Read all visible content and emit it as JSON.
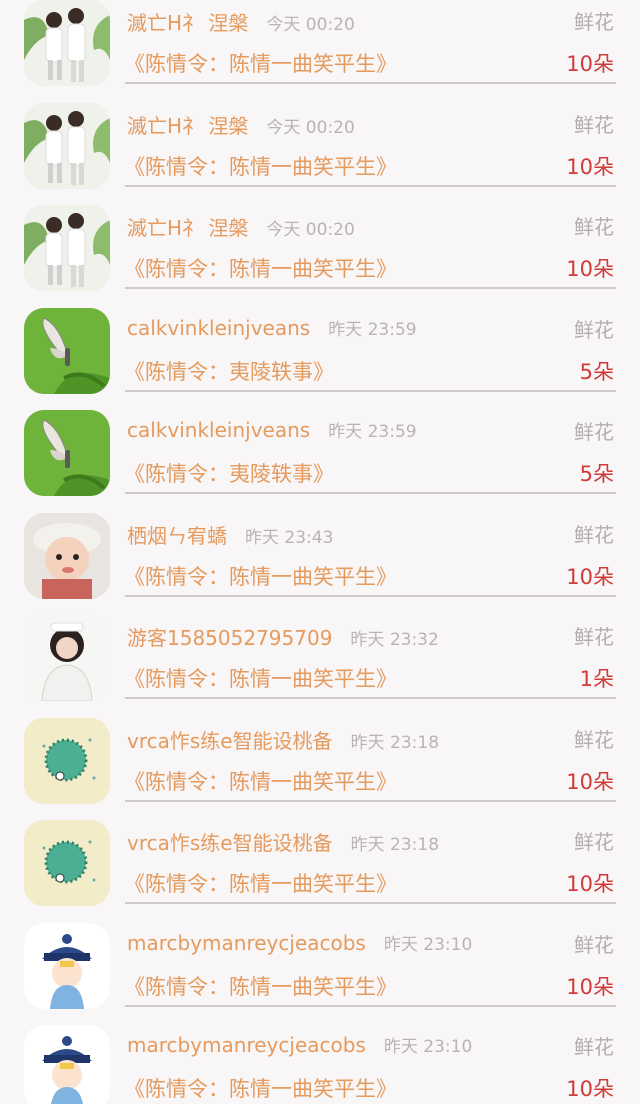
{
  "gift_list": {
    "items": [
      {
        "avatar": "avatar-boys-photo-icon",
        "name": "滅亡H礻 涅槃",
        "time": "今天 00:20",
        "gift": "鲜花",
        "title": "《陈情令：陈情一曲笑平生》",
        "count": "10朵"
      },
      {
        "avatar": "avatar-boys-photo-icon",
        "name": "滅亡H礻 涅槃",
        "time": "今天 00:20",
        "gift": "鲜花",
        "title": "《陈情令：陈情一曲笑平生》",
        "count": "10朵"
      },
      {
        "avatar": "avatar-boys-photo-icon",
        "name": "滅亡H礻 涅槃",
        "time": "今天 00:20",
        "gift": "鲜花",
        "title": "《陈情令：陈情一曲笑平生》",
        "count": "10朵"
      },
      {
        "avatar": "avatar-butterfly-icon",
        "name": "calkvinkleinjveans",
        "time": "昨天 23:59",
        "gift": "鲜花",
        "title": "《陈情令：夷陵轶事》",
        "count": "5朵"
      },
      {
        "avatar": "avatar-butterfly-icon",
        "name": "calkvinkleinjveans",
        "time": "昨天 23:59",
        "gift": "鲜花",
        "title": "《陈情令：夷陵轶事》",
        "count": "5朵"
      },
      {
        "avatar": "avatar-child-photo-icon",
        "name": "栖烟ㄣ宥蟜",
        "time": "昨天 23:43",
        "gift": "鲜花",
        "title": "《陈情令：陈情一曲笑平生》",
        "count": "10朵"
      },
      {
        "avatar": "avatar-girl-photo-icon",
        "name": "游客1585052795709",
        "time": "昨天 23:32",
        "gift": "鲜花",
        "title": "《陈情令：陈情一曲笑平生》",
        "count": "1朵"
      },
      {
        "avatar": "avatar-green-ball-icon",
        "name": "vrca怍s练e智能设桃备",
        "time": "昨天 23:18",
        "gift": "鲜花",
        "title": "《陈情令：陈情一曲笑平生》",
        "count": "10朵"
      },
      {
        "avatar": "avatar-green-ball-icon",
        "name": "vrca怍s练e智能设桃备",
        "time": "昨天 23:18",
        "gift": "鲜花",
        "title": "《陈情令：陈情一曲笑平生》",
        "count": "10朵"
      },
      {
        "avatar": "avatar-cartoon-official-icon",
        "name": "marcbymanreycjeacobs",
        "time": "昨天 23:10",
        "gift": "鲜花",
        "title": "《陈情令：陈情一曲笑平生》",
        "count": "10朵"
      },
      {
        "avatar": "avatar-cartoon-official-icon",
        "name": "marcbymanreycjeacobs",
        "time": "昨天 23:10",
        "gift": "鲜花",
        "title": "《陈情令：陈情一曲笑平生》",
        "count": "10朵"
      }
    ]
  },
  "colors": {
    "name": "#e59a5e",
    "count": "#d23a3a",
    "muted": "#b3aeae",
    "background": "#f8f6f6"
  }
}
